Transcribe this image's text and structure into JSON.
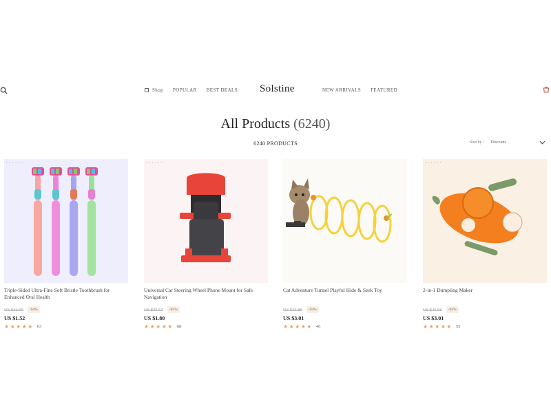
{
  "header": {
    "nav_left": [
      "Shop",
      "POPULAR",
      "BEST DEALS"
    ],
    "logo": "Solstine",
    "nav_right": [
      "NEW ARRIVALS",
      "FEATURED"
    ],
    "icons": [
      "search-icon",
      "menu-icon",
      "cart-icon"
    ]
  },
  "main": {
    "title": "All Products",
    "title_count": "(6240)",
    "product_count": "6240 PRODUCTS",
    "sort_label": "Sort by :",
    "sort_value": "Discount"
  },
  "products": [
    {
      "name": "Triple-Sided Ultra-Fine Soft Bristle Toothbrush for Enhanced Oral Health",
      "old_price": "US $26.99",
      "discount": "-94%",
      "price": "US $1.52",
      "rating": 5,
      "reviews": "63"
    },
    {
      "name": "Universal Car Steering Wheel Phone Mount for Safe Navigation",
      "old_price": "US $35.63",
      "discount": "-95%",
      "price": "US $1.80",
      "rating": 5,
      "reviews": "68"
    },
    {
      "name": "Cat Adventure Tunnel Playful Hide & Seek Toy",
      "old_price": "US $43.80",
      "discount": "-93%",
      "price": "US $3.01",
      "rating": 5,
      "reviews": "46"
    },
    {
      "name": "2-in-1 Dumpling Maker",
      "old_price": "US $45.96",
      "discount": "-93%",
      "price": "US $3.01",
      "rating": 5,
      "reviews": "55"
    }
  ],
  "colors": {
    "accent_star": "#e5a36a",
    "discount_bg": "#f7efe6"
  }
}
